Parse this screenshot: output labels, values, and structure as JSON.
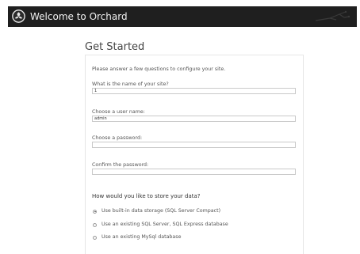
{
  "header": {
    "title": "Welcome to Orchard",
    "logo_icon": "orchard-logo-icon",
    "background": "#1f1f1f"
  },
  "page": {
    "title": "Get Started"
  },
  "form": {
    "intro": "Please answer a few questions to configure your site.",
    "site_name": {
      "label": "What is the name of your site?",
      "value": "1"
    },
    "user_name": {
      "label": "Choose a user name:",
      "value": "admin"
    },
    "password": {
      "label": "Choose a password:",
      "value": ""
    },
    "confirm_password": {
      "label": "Confirm the password:",
      "value": ""
    },
    "storage": {
      "heading": "How would you like to store your data?",
      "selected_index": 0,
      "options": [
        "Use built-in data storage (SQL Server Compact)",
        "Use an existing SQL Server, SQL Express database",
        "Use an existing MySql database"
      ]
    }
  }
}
